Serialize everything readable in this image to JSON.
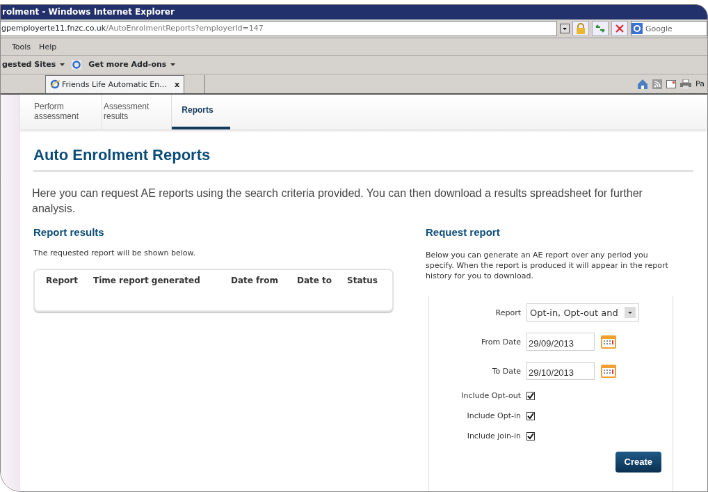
{
  "window": {
    "title": "rolment - Windows Internet Explorer"
  },
  "address_bar": {
    "host": "gpemployerte11.fnzc.co.uk",
    "path": "/AutoEnrolmentReports?employerId=147",
    "search_placeholder": "Google"
  },
  "menu": [
    {
      "label": "Tools"
    },
    {
      "label": "Help"
    }
  ],
  "favorites_bar": [
    {
      "label": "gested Sites",
      "kind": "dropdown"
    },
    {
      "label": "Get more Add-ons",
      "kind": "addon"
    }
  ],
  "browser_tab": {
    "label": "Friends Life Automatic En...",
    "close": "x"
  },
  "command_bar": {
    "label": "Pa"
  },
  "page_tabs": [
    {
      "label": "Perform assessment",
      "selected": false
    },
    {
      "label": "Assessment results",
      "selected": false
    },
    {
      "label": "Reports",
      "selected": true
    }
  ],
  "heading": "Auto Enrolment Reports",
  "intro": "Here you can request AE reports using the search criteria provided. You can then download a results spreadsheet for further analysis.",
  "report_results": {
    "title": "Report results",
    "note": "The requested report will be shown below.",
    "columns": [
      "Report",
      "Time report generated",
      "Date from",
      "Date to",
      "Status"
    ]
  },
  "request_report": {
    "title": "Request report",
    "note": "Below you can generate an AE report over any period you specify. When the report is produced it will appear in the report history for you to download.",
    "fields": [
      {
        "label": "Report",
        "kind": "select",
        "value": "Opt-in, Opt-out and"
      },
      {
        "label": "From Date",
        "kind": "date",
        "value": "29/09/2013"
      },
      {
        "label": "To Date",
        "kind": "date",
        "value": "29/10/2013"
      },
      {
        "label": "Include Opt-out",
        "kind": "checkbox",
        "checked": true
      },
      {
        "label": "Include Opt-in",
        "kind": "checkbox",
        "checked": true
      },
      {
        "label": "Include join-in",
        "kind": "checkbox",
        "checked": true
      }
    ],
    "button": "Create"
  }
}
